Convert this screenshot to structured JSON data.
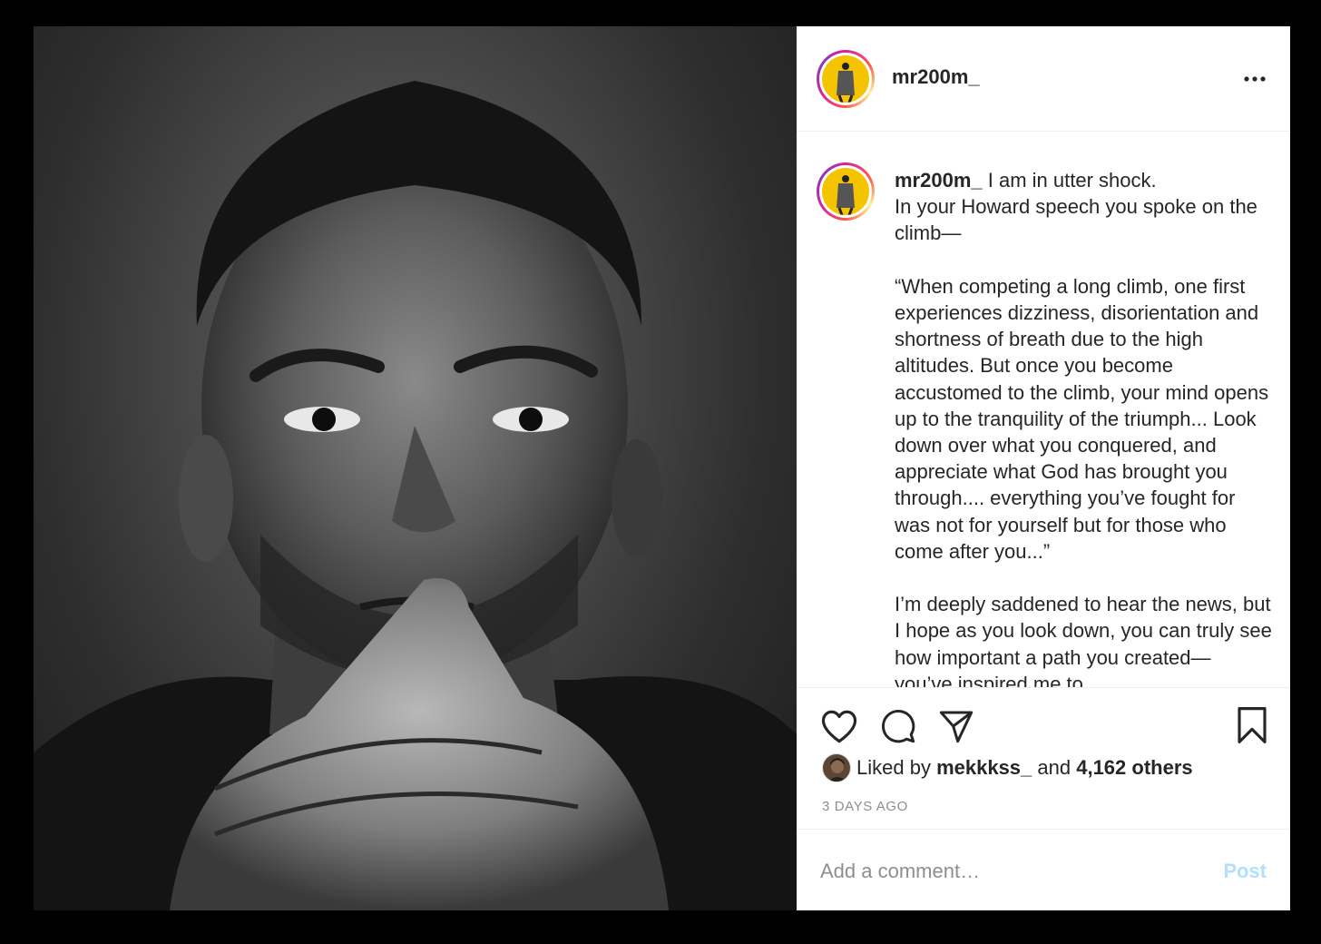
{
  "post": {
    "username": "mr200m_",
    "caption": {
      "username": "mr200m_",
      "text": " I am in utter shock.\nIn your Howard speech you spoke on the climb—\n\n“When competing a long climb, one first experiences dizziness, disorientation and shortness of breath due to the high altitudes. But once you become accustomed to the climb, your mind opens up to the tranquility of the triumph... Look down over what you conquered, and appreciate what God has brought you through.... everything you’ve fought for was not for yourself but for those who come after you...”\n\nI’m deeply saddened to hear the news, but I hope as you look down, you can truly see how important a path you created— you’ve inspired me to"
    },
    "likes": {
      "prefix": "Liked by ",
      "user": "mekkkss_",
      "middle": " and ",
      "count": "4,162 others"
    },
    "timestamp": "3 DAYS AGO",
    "comment": {
      "placeholder": "Add a comment…",
      "post_label": "Post"
    }
  },
  "icons": {
    "more": "more-horizontal-icon",
    "like": "heart-icon",
    "comment": "comment-bubble-icon",
    "share": "paper-plane-icon",
    "save": "bookmark-icon"
  },
  "colors": {
    "post_button_disabled": "#b2dffc",
    "avatar_background": "#f5c400",
    "secondary_text": "#8e8e8e"
  }
}
